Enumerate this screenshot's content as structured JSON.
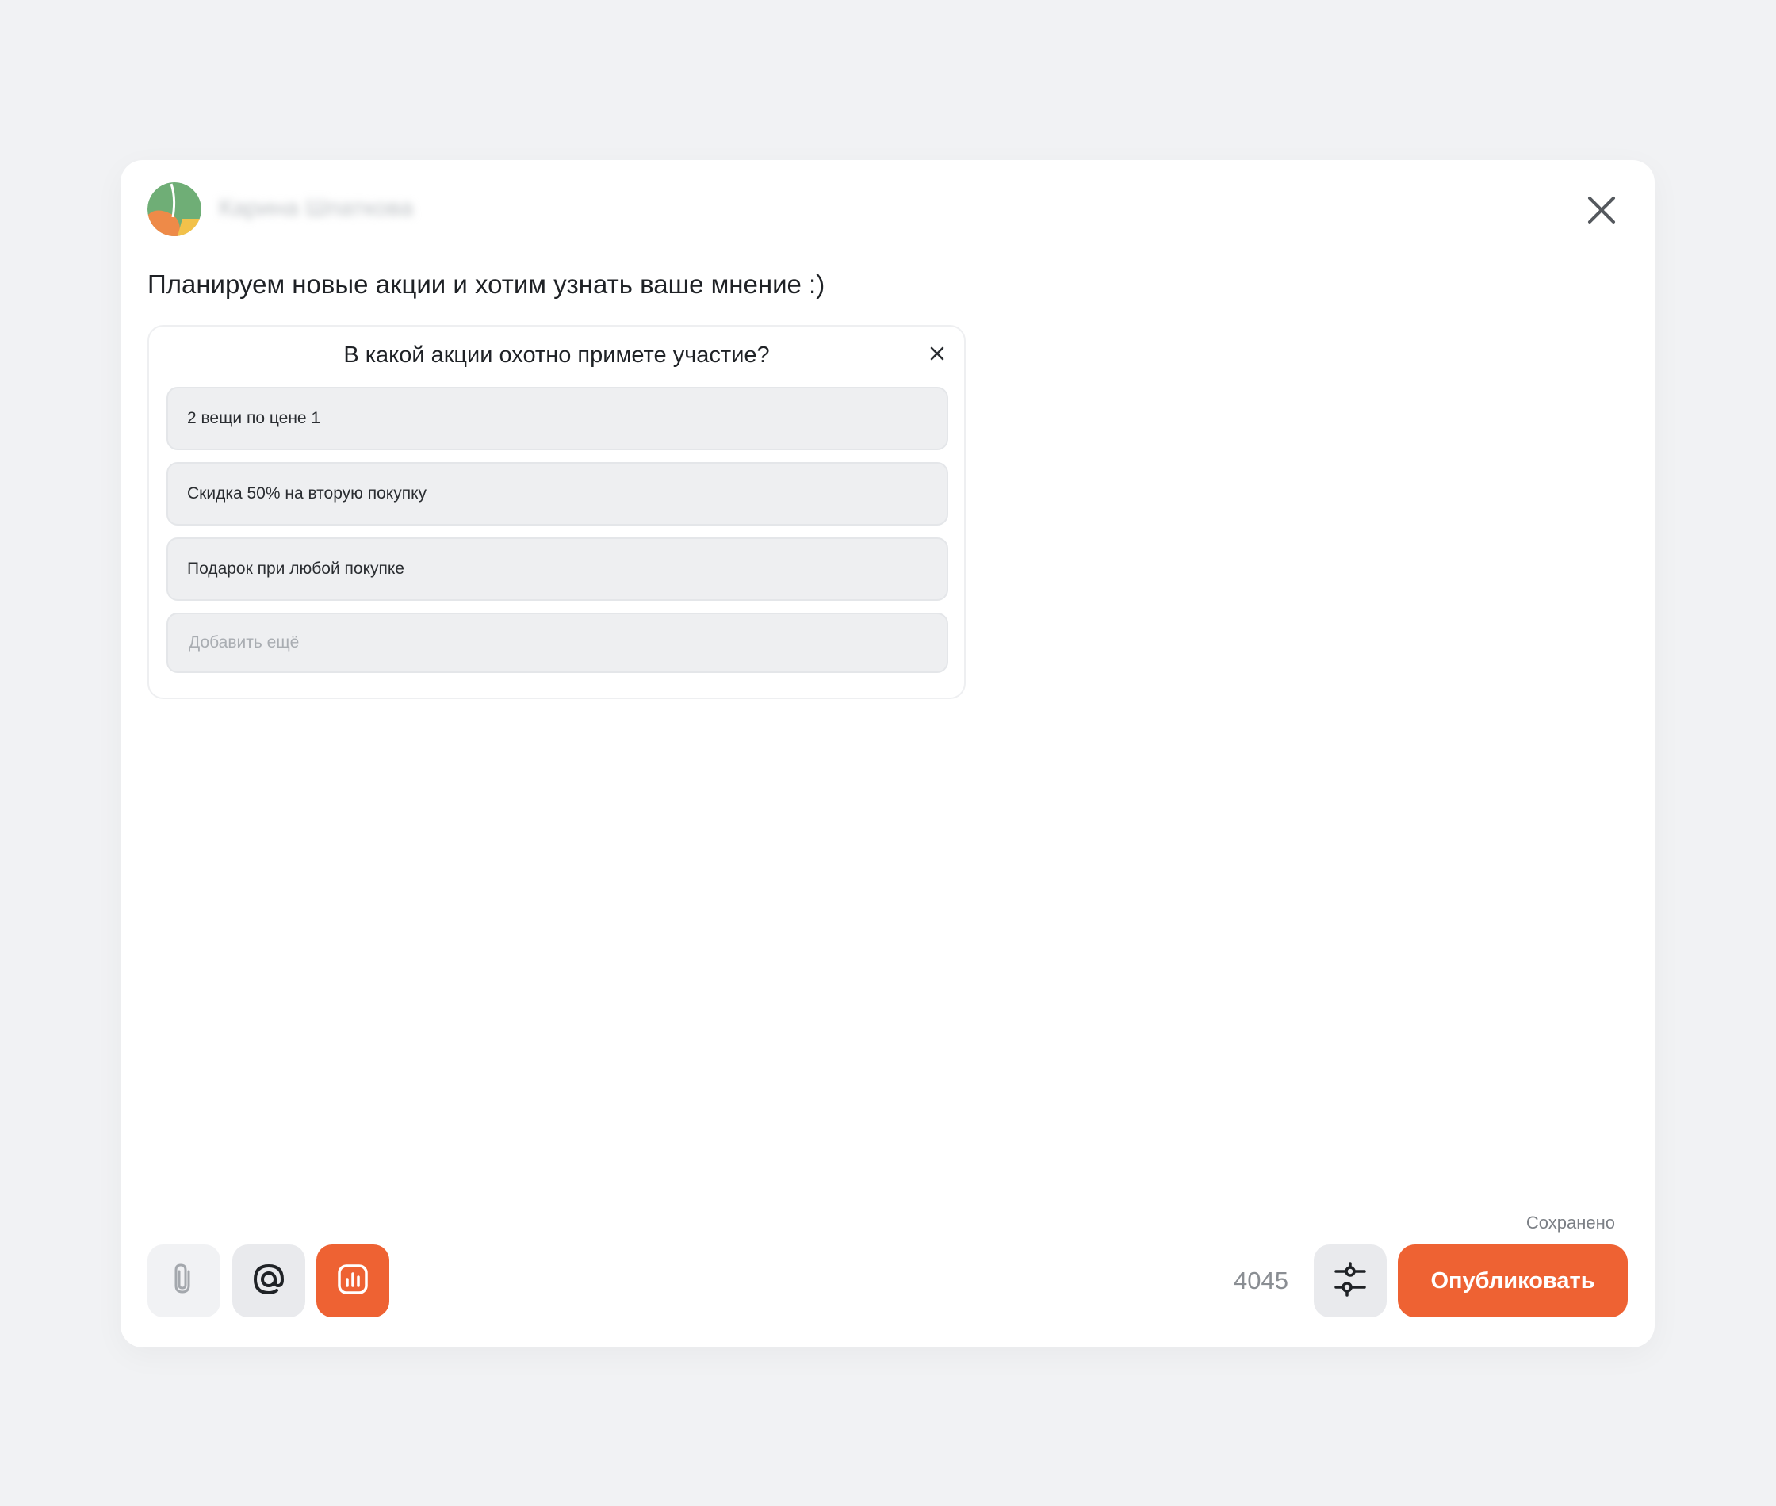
{
  "author": {
    "name": "Карина Шпаткова"
  },
  "post": {
    "text": "Планируем новые акции и хотим узнать ваше мнение :)"
  },
  "poll": {
    "question": "В какой акции охотно примете участие?",
    "options": [
      {
        "label": "2 вещи по цене 1"
      },
      {
        "label": "Скидка 50% на вторую покупку"
      },
      {
        "label": "Подарок при любой покупке"
      }
    ],
    "add_placeholder": "Добавить ещё"
  },
  "footer": {
    "saved_label": "Сохранено",
    "char_count": "4045",
    "publish_label": "Опубликовать"
  },
  "icons": {
    "attach": "paperclip-icon",
    "mention": "at-sign-icon",
    "poll": "poll-chart-icon",
    "settings": "sliders-icon",
    "close": "close-icon"
  },
  "colors": {
    "accent": "#ee6233",
    "tool_bg": "#f1f2f4",
    "tool_bg_active": "#e9eaed",
    "option_bg": "#eeeff1"
  }
}
